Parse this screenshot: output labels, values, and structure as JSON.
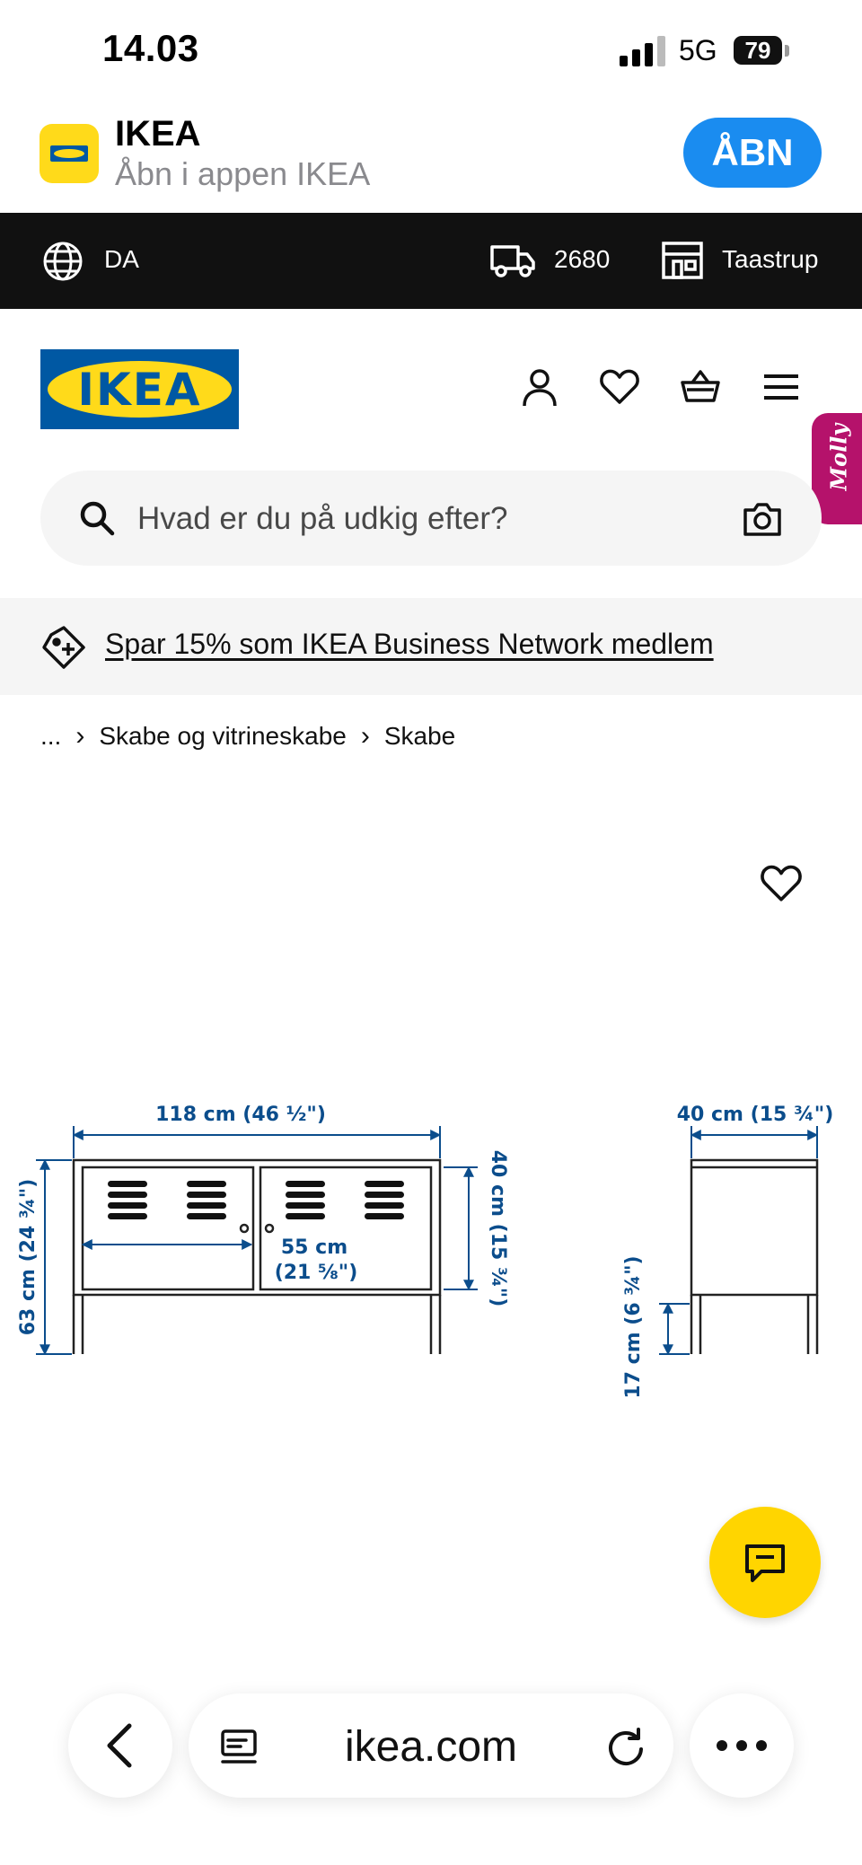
{
  "status_bar": {
    "time": "14.03",
    "network": "5G",
    "battery": "79",
    "battery_percent": 79
  },
  "app_banner": {
    "name": "IKEA",
    "subtitle": "Åbn i appen IKEA",
    "open_label": "ÅBN"
  },
  "top_bar": {
    "language": "DA",
    "postcode": "2680",
    "store": "Taastrup"
  },
  "header": {
    "logo_text": "IKEA",
    "molly_label": "Molly"
  },
  "search": {
    "placeholder": "Hvad er du på udkig efter?"
  },
  "promo": {
    "text": "Spar 15% som IKEA Business Network medlem"
  },
  "breadcrumb": {
    "items": [
      "...",
      "Skabe og vitrineskabe",
      "Skabe"
    ],
    "separator": "›"
  },
  "product_image": {
    "width_label": "118 cm (46 ½\")",
    "height_label": "63 cm (24 ¾\")",
    "inner_height_label": "40 cm (15 ¾\")",
    "inner_width_line1": "55 cm",
    "inner_width_line2": "(21 ⅝\")",
    "depth_label": "40 cm (15 ¾\")",
    "leg_height_label": "17 cm (6 ¾\")"
  },
  "browser": {
    "url": "ikea.com"
  },
  "colors": {
    "ikea_blue": "#0058a3",
    "ikea_yellow": "#ffda1a",
    "dark_bar": "#111111",
    "open_button": "#1a8cf0",
    "molly": "#b5126b",
    "chat": "#ffd500",
    "dimension": "#0b4d8c"
  },
  "icons": [
    "signal-icon",
    "globe-icon",
    "truck-icon",
    "store-icon",
    "user-icon",
    "heart-icon",
    "basket-icon",
    "menu-icon",
    "search-icon",
    "camera-icon",
    "tag-icon",
    "chat-icon",
    "back-icon",
    "tabs-icon",
    "reload-icon",
    "more-icon"
  ]
}
